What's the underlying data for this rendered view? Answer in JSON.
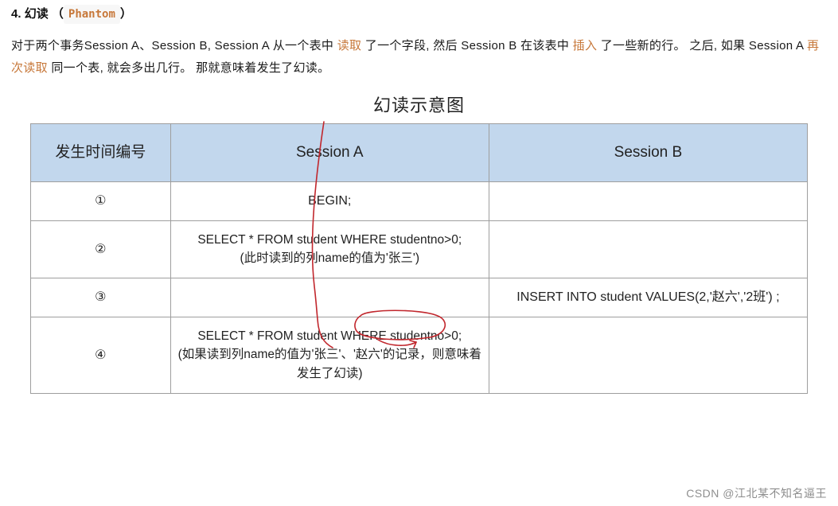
{
  "heading": {
    "number": "4.",
    "title_cn": "幻读",
    "paren_open": "（",
    "code": "Phantom",
    "paren_close": "）"
  },
  "paragraph": {
    "t1": "对于两个事务Session A、Session B, Session A 从一个表中 ",
    "kw1": "读取",
    "t2": " 了一个字段, 然后 Session B 在该表中 ",
    "kw2": "插入",
    "t3": " 了一些新的行。 之后, 如果 Session A  ",
    "kw3": "再次读取",
    "t4": " 同一个表, 就会多出几行。 那就意味着发生了幻读。"
  },
  "diagram_title": "幻读示意图",
  "table": {
    "headers": {
      "c1": "发生时间编号",
      "c2": "Session A",
      "c3": "Session B"
    },
    "rows": [
      {
        "n": "①",
        "a": "BEGIN;",
        "b": ""
      },
      {
        "n": "②",
        "a_sql": "SELECT * FROM student WHERE studentno>0;",
        "a_note": "(此时读到的列name的值为'张三')",
        "b": ""
      },
      {
        "n": "③",
        "a": "",
        "b": "INSERT INTO student VALUES(2,'赵六','2班') ;"
      },
      {
        "n": "④",
        "a_sql": "SELECT * FROM student WHERE studentno>0;",
        "a_note": "(如果读到列name的值为'张三'、'赵六'的记录，则意味着发生了幻读)",
        "b": ""
      }
    ]
  },
  "watermark": "CSDN @江北某不知名逼王"
}
